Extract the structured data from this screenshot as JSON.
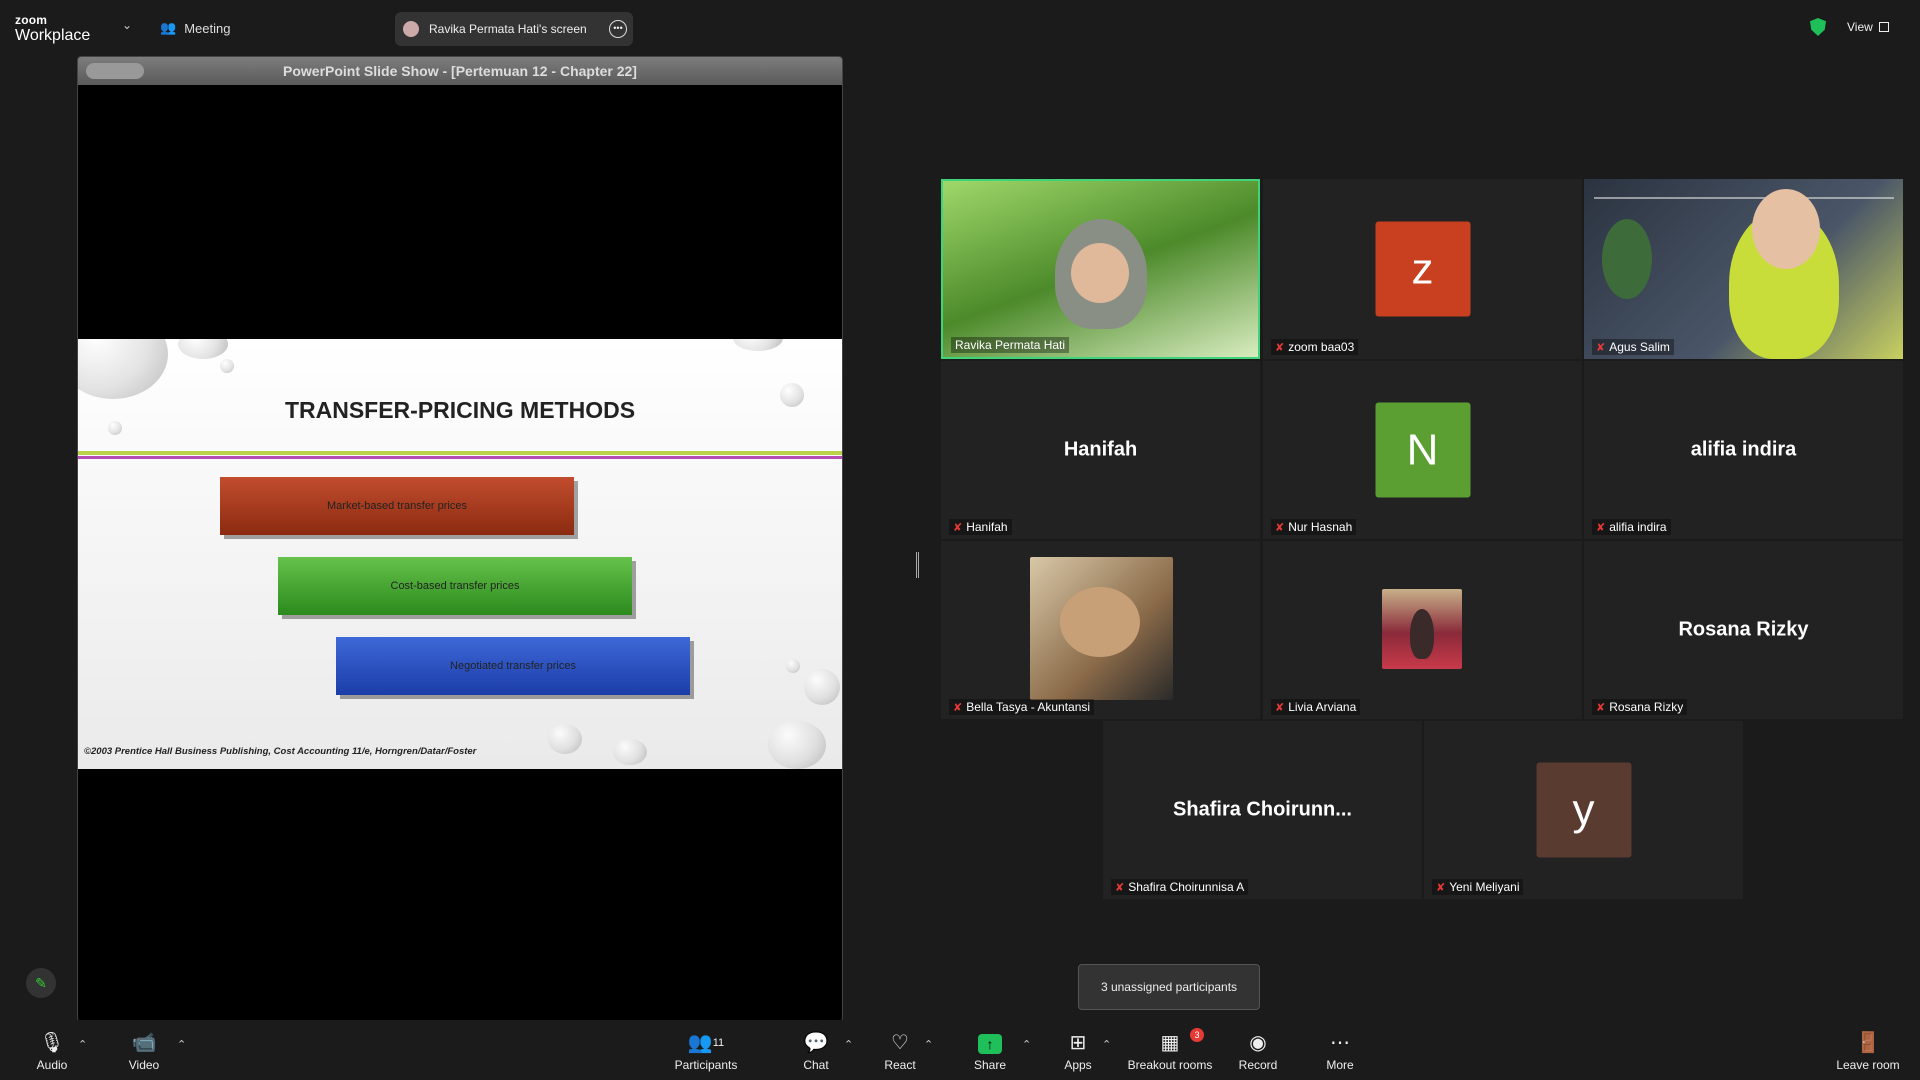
{
  "app": {
    "brand_top": "zoom",
    "brand_bottom": "Workplace",
    "meeting_label": "Meeting",
    "view_label": "View"
  },
  "screen_pill": {
    "label": "Ravika Permata Hati's screen"
  },
  "share": {
    "window_title": "PowerPoint Slide Show - [Pertemuan 12 - Chapter 22]",
    "slide_title": "TRANSFER-PRICING METHODS",
    "methods": [
      "Market-based transfer prices",
      "Cost-based transfer prices",
      "Negotiated transfer prices"
    ],
    "copyright": "©2003 Prentice Hall Business Publishing, Cost Accounting 11/e, Horngren/Datar/Foster"
  },
  "participants": [
    {
      "name": "Ravika Permata Hati",
      "kind": "video"
    },
    {
      "name": "zoom baa03",
      "kind": "letter",
      "letter": "z",
      "color": "#c8401f"
    },
    {
      "name": "Agus Salim",
      "kind": "video"
    },
    {
      "name": "Hanifah",
      "kind": "name",
      "display": "Hanifah"
    },
    {
      "name": "Nur Hasnah",
      "kind": "letter",
      "letter": "N",
      "color": "#5b9e32"
    },
    {
      "name": "alifia indira",
      "kind": "name",
      "display": "alifia indira"
    },
    {
      "name": "Bella Tasya - Akuntansi",
      "kind": "photo"
    },
    {
      "name": "Livia Arviana",
      "kind": "photo"
    },
    {
      "name": "Rosana Rizky",
      "kind": "name",
      "display": "Rosana Rizky"
    },
    {
      "name": "Shafira Choirunnisa A",
      "kind": "name",
      "display": "Shafira  Choirunn..."
    },
    {
      "name": "Yeni Meliyani",
      "kind": "letter",
      "letter": "y",
      "color": "#5a3b30"
    }
  ],
  "tooltip": "3 unassigned participants",
  "toolbar": {
    "audio": "Audio",
    "video": "Video",
    "participants": "Participants",
    "participants_count": "11",
    "chat": "Chat",
    "react": "React",
    "share": "Share",
    "apps": "Apps",
    "breakout": "Breakout rooms",
    "breakout_badge": "3",
    "record": "Record",
    "more": "More",
    "leave": "Leave room"
  },
  "colors": {
    "active_speaker": "#3fd37a",
    "accent_green": "#1fbf5a",
    "muted_red": "#e53935"
  }
}
